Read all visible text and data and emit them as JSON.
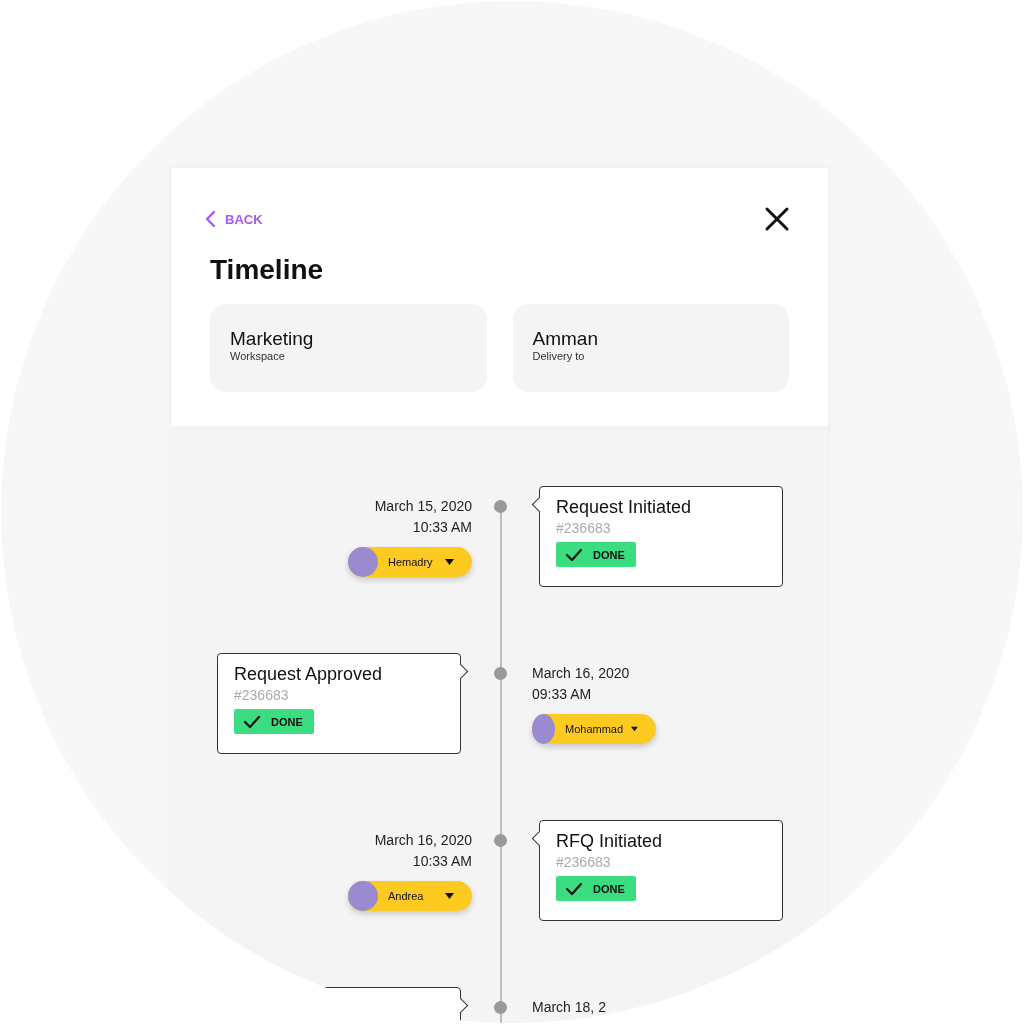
{
  "header": {
    "back": "BACK",
    "title": "Timeline"
  },
  "info_cards": [
    {
      "value": "Marketing",
      "label": "Workspace"
    },
    {
      "value": "Amman",
      "label": "Delivery to"
    }
  ],
  "events": [
    {
      "kind": "card-right",
      "date": "March 15, 2020",
      "time": "10:33 AM",
      "person": "Hemadry",
      "title": "Request Initiated",
      "number": "#236683",
      "status": "DONE"
    },
    {
      "kind": "card-left",
      "date": "March 16, 2020",
      "time": "09:33 AM",
      "person": "Mohammad",
      "title": "Request Approved",
      "number": "#236683",
      "status": "DONE"
    },
    {
      "kind": "card-right",
      "date": "March 16, 2020",
      "time": "10:33 AM",
      "person": "Andrea",
      "title": "RFQ Initiated",
      "number": "#236683",
      "status": "DONE"
    },
    {
      "kind": "card-left",
      "date": "March 18, 2"
    }
  ]
}
